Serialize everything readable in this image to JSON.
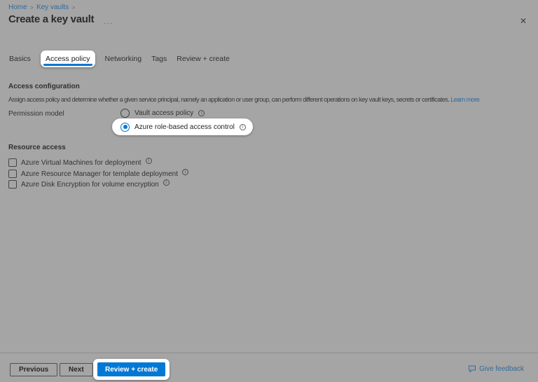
{
  "icons": {
    "close": "✕",
    "more": "···",
    "separator": ">",
    "info": "i"
  },
  "colors": {
    "accent": "#0078d4",
    "overlay_background": "#a5a5a5",
    "highlight_background": "#ffffff"
  },
  "breadcrumb": {
    "items": [
      {
        "label": "Home"
      },
      {
        "label": "Key vaults"
      }
    ]
  },
  "header": {
    "title": "Create a key vault"
  },
  "tabs": {
    "active": "Access policy",
    "items": [
      {
        "label": "Basics"
      },
      {
        "label": "Access policy"
      },
      {
        "label": "Networking"
      },
      {
        "label": "Tags"
      },
      {
        "label": "Review + create"
      }
    ]
  },
  "access_configuration": {
    "heading": "Access configuration",
    "description": "Assign access policy and determine whether a given service principal, namely an application or user group, can perform different operations on key vault keys, secrets or certificates.",
    "learn_more_label": "Learn more",
    "permission_model": {
      "label": "Permission model",
      "options": [
        {
          "label": "Vault access policy",
          "selected": false,
          "highlighted": false
        },
        {
          "label": "Azure role-based access control",
          "selected": true,
          "highlighted": true
        }
      ]
    }
  },
  "resource_access": {
    "heading": "Resource access",
    "options": [
      {
        "label": "Azure Virtual Machines for deployment",
        "checked": false
      },
      {
        "label": "Azure Resource Manager for template deployment",
        "checked": false
      },
      {
        "label": "Azure Disk Encryption for volume encryption",
        "checked": false
      }
    ]
  },
  "footer": {
    "previous_label": "Previous",
    "next_label": "Next",
    "review_create_label": "Review + create",
    "feedback_label": "Give feedback"
  }
}
